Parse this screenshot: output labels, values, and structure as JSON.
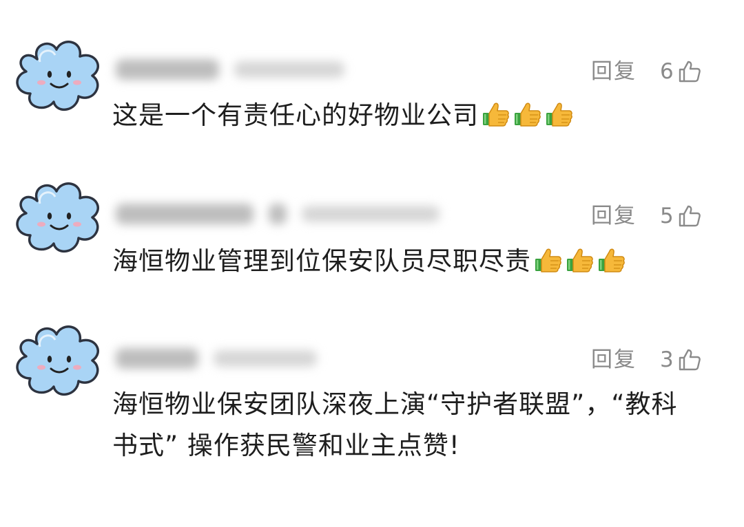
{
  "comments": [
    {
      "reply_label": "回复",
      "like_count": "6",
      "text": "这是一个有责任心的好物业公司",
      "emoji_count": 3
    },
    {
      "reply_label": "回复",
      "like_count": "5",
      "text": "海恒物业管理到位保安队员尽职尽责",
      "emoji_count": 3
    },
    {
      "reply_label": "回复",
      "like_count": "3",
      "text": "海恒物业保安团队深夜上演“守护者联盟”，“教科书式” 操作获民警和业主点赞!",
      "emoji_count": 0
    }
  ],
  "icons": {
    "avatar": "blue-cloud-smiley-icon",
    "like": "thumbs-up-outline-icon",
    "emoji": "thumbs-up-emoji-icon"
  },
  "colors": {
    "avatar_fill": "#a9d4f5",
    "meta_text": "#8a8a8a",
    "body_text": "#1e1e1e"
  }
}
